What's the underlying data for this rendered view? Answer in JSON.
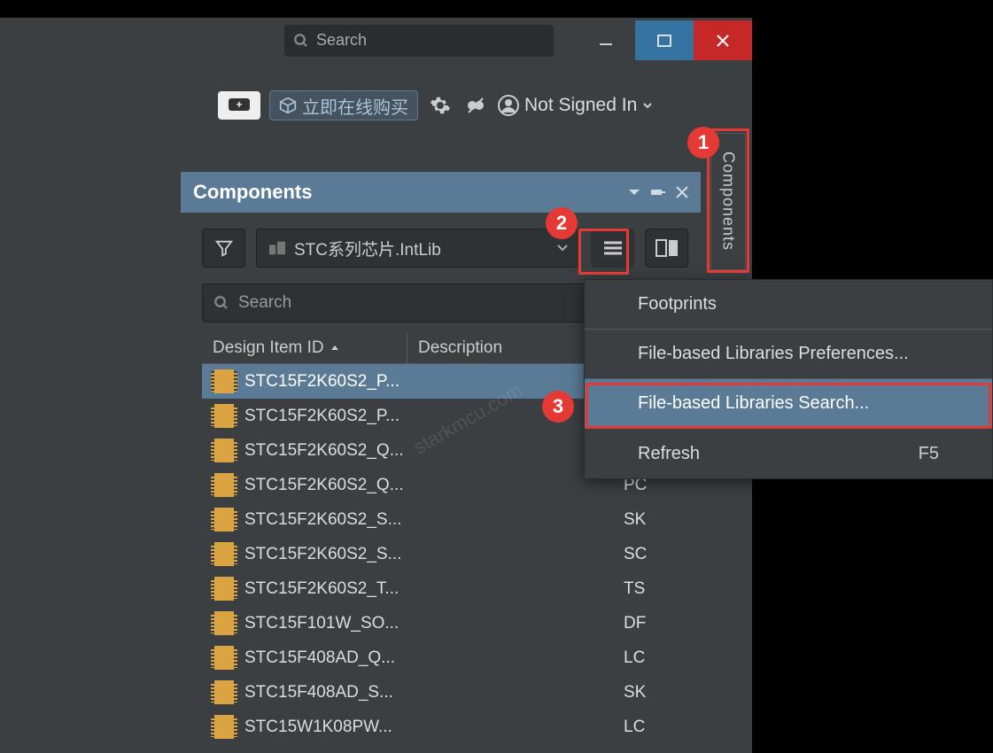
{
  "titlebar": {
    "search_placeholder": "Search"
  },
  "toolbar": {
    "buy_label": "立即在线购买",
    "user_label": "Not Signed In"
  },
  "panel": {
    "title": "Components",
    "library_name": "STC系列芯片.IntLib",
    "search_placeholder": "Search",
    "columns": {
      "name": "Design Item ID",
      "desc": "Description"
    },
    "rows": [
      {
        "name": "STC15F2K60S2_P...",
        "desc": ""
      },
      {
        "name": "STC15F2K60S2_P...",
        "desc": ""
      },
      {
        "name": "STC15F2K60S2_Q...",
        "desc": ""
      },
      {
        "name": "STC15F2K60S2_Q...",
        "desc": "PC"
      },
      {
        "name": "STC15F2K60S2_S...",
        "desc": "SK"
      },
      {
        "name": "STC15F2K60S2_S...",
        "desc": "SC"
      },
      {
        "name": "STC15F2K60S2_T...",
        "desc": "TS"
      },
      {
        "name": "STC15F101W_SO...",
        "desc": "DF"
      },
      {
        "name": "STC15F408AD_Q...",
        "desc": "LC"
      },
      {
        "name": "STC15F408AD_S...",
        "desc": "SK"
      },
      {
        "name": "STC15W1K08PW...",
        "desc": "LC"
      }
    ]
  },
  "side_tab": {
    "label": "Components"
  },
  "context_menu": {
    "items": [
      {
        "label": "Footprints",
        "shortcut": ""
      },
      {
        "label": "File-based Libraries Preferences...",
        "shortcut": ""
      },
      {
        "label": "File-based Libraries Search...",
        "shortcut": ""
      },
      {
        "label": "Refresh",
        "shortcut": "F5"
      }
    ]
  },
  "annotations": {
    "b1": "1",
    "b2": "2",
    "b3": "3"
  },
  "watermark": "starkmcu.com"
}
